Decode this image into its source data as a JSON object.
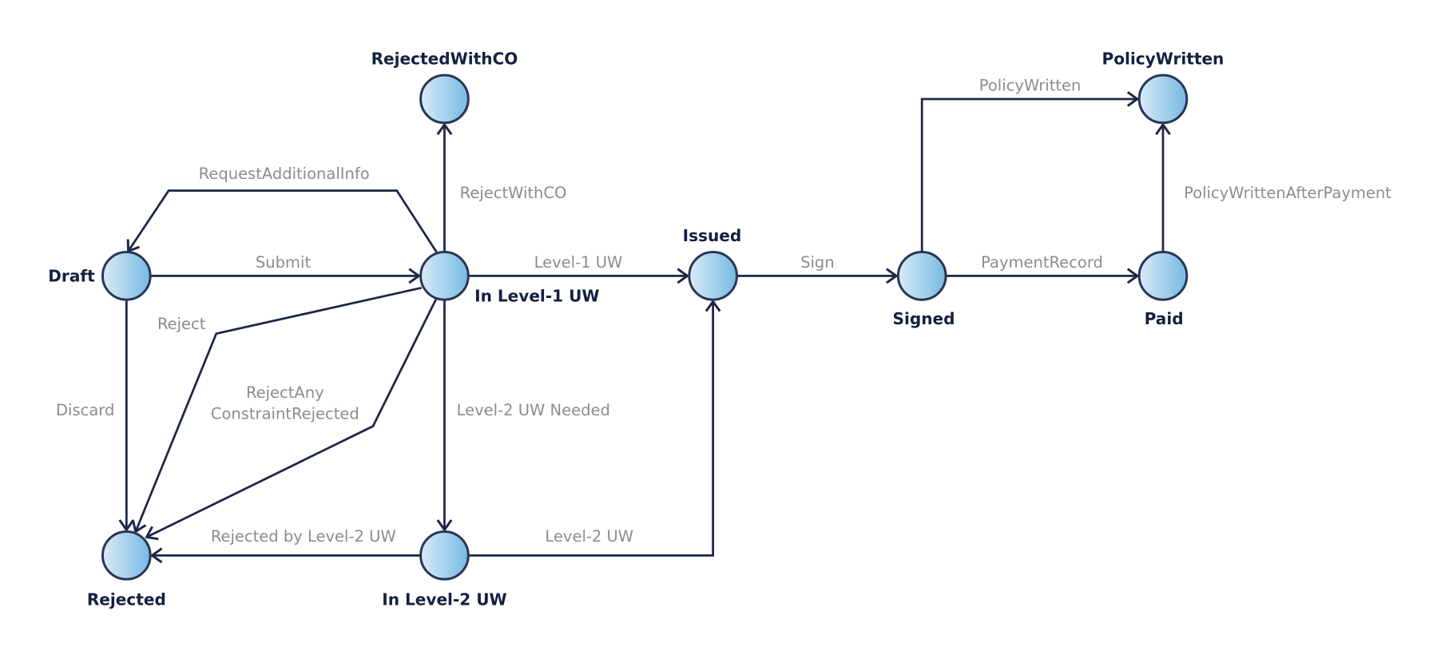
{
  "diagram": {
    "colors": {
      "line": "#1d2747",
      "edge_label": "#8c8c8c",
      "node_label": "#14203f",
      "node_fill_light": "#d9ecf8",
      "node_fill_dark": "#76b9e2",
      "node_stroke": "#2a3556"
    },
    "states": [
      {
        "id": "draft",
        "label": "Draft"
      },
      {
        "id": "l1",
        "label": "In Level-1 UW"
      },
      {
        "id": "rejco",
        "label": "RejectedWithCO"
      },
      {
        "id": "issued",
        "label": "Issued"
      },
      {
        "id": "signed",
        "label": "Signed"
      },
      {
        "id": "paid",
        "label": "Paid"
      },
      {
        "id": "policy",
        "label": "PolicyWritten"
      },
      {
        "id": "rejected",
        "label": "Rejected"
      },
      {
        "id": "l2",
        "label": "In Level-2 UW"
      }
    ],
    "transitions": [
      {
        "id": "submit",
        "from": "draft",
        "to": "l1",
        "label": [
          "Submit"
        ]
      },
      {
        "id": "reqinfo",
        "from": "l1",
        "to": "draft",
        "label": [
          "RequestAdditionalInfo"
        ]
      },
      {
        "id": "rejectco",
        "from": "l1",
        "to": "rejco",
        "label": [
          "RejectWithCO"
        ]
      },
      {
        "id": "l1uw",
        "from": "l1",
        "to": "issued",
        "label": [
          "Level-1 UW"
        ]
      },
      {
        "id": "sign",
        "from": "issued",
        "to": "signed",
        "label": [
          "Sign"
        ]
      },
      {
        "id": "payment",
        "from": "signed",
        "to": "paid",
        "label": [
          "PaymentRecord"
        ]
      },
      {
        "id": "policywritten",
        "from": "signed",
        "to": "policy",
        "label": [
          "PolicyWritten"
        ]
      },
      {
        "id": "pwap",
        "from": "paid",
        "to": "policy",
        "label": [
          "PolicyWrittenAfterPayment"
        ]
      },
      {
        "id": "discard",
        "from": "draft",
        "to": "rejected",
        "label": [
          "Discard"
        ]
      },
      {
        "id": "reject",
        "from": "l1",
        "to": "rejected",
        "label": [
          "Reject"
        ]
      },
      {
        "id": "rejectany",
        "from": "l1",
        "to": "rejected",
        "label": [
          "RejectAny",
          "ConstraintRejected"
        ]
      },
      {
        "id": "l2needed",
        "from": "l1",
        "to": "l2",
        "label": [
          "Level-2 UW Needed"
        ]
      },
      {
        "id": "rejl2",
        "from": "l2",
        "to": "rejected",
        "label": [
          "Rejected by Level-2 UW"
        ]
      },
      {
        "id": "l2uw",
        "from": "l2",
        "to": "issued",
        "label": [
          "Level-2 UW"
        ]
      }
    ]
  }
}
